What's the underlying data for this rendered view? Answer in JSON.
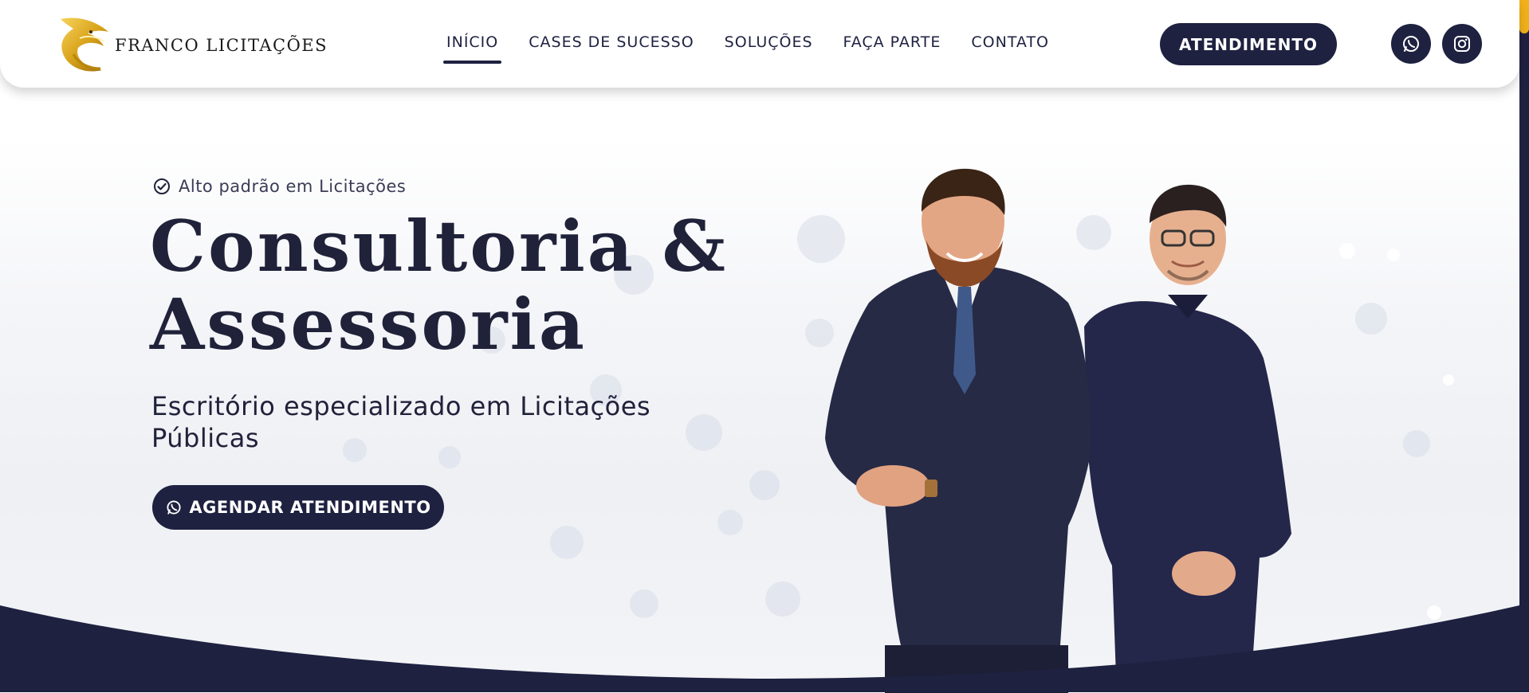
{
  "header": {
    "logo_text": "FRANCO LICITAÇÕES",
    "nav": [
      {
        "label": "INÍCIO",
        "active": true
      },
      {
        "label": "CASES DE SUCESSO",
        "active": false
      },
      {
        "label": "SOLUÇÕES",
        "active": false
      },
      {
        "label": "FAÇA PARTE",
        "active": false
      },
      {
        "label": "CONTATO",
        "active": false
      }
    ],
    "cta_label": "ATENDIMENTO",
    "social_icons": [
      "whatsapp-icon",
      "instagram-icon"
    ]
  },
  "hero": {
    "tagline": "Alto padrão em Licitações",
    "headline_line1": "Consultoria &",
    "headline_line2": "Assessoria",
    "subheading": "Escritório especializado em Licitações Públicas",
    "cta_label": "AGENDAR ATENDIMENTO"
  },
  "colors": {
    "navy": "#1e2140",
    "gold": "#f2b21b",
    "white": "#ffffff"
  }
}
